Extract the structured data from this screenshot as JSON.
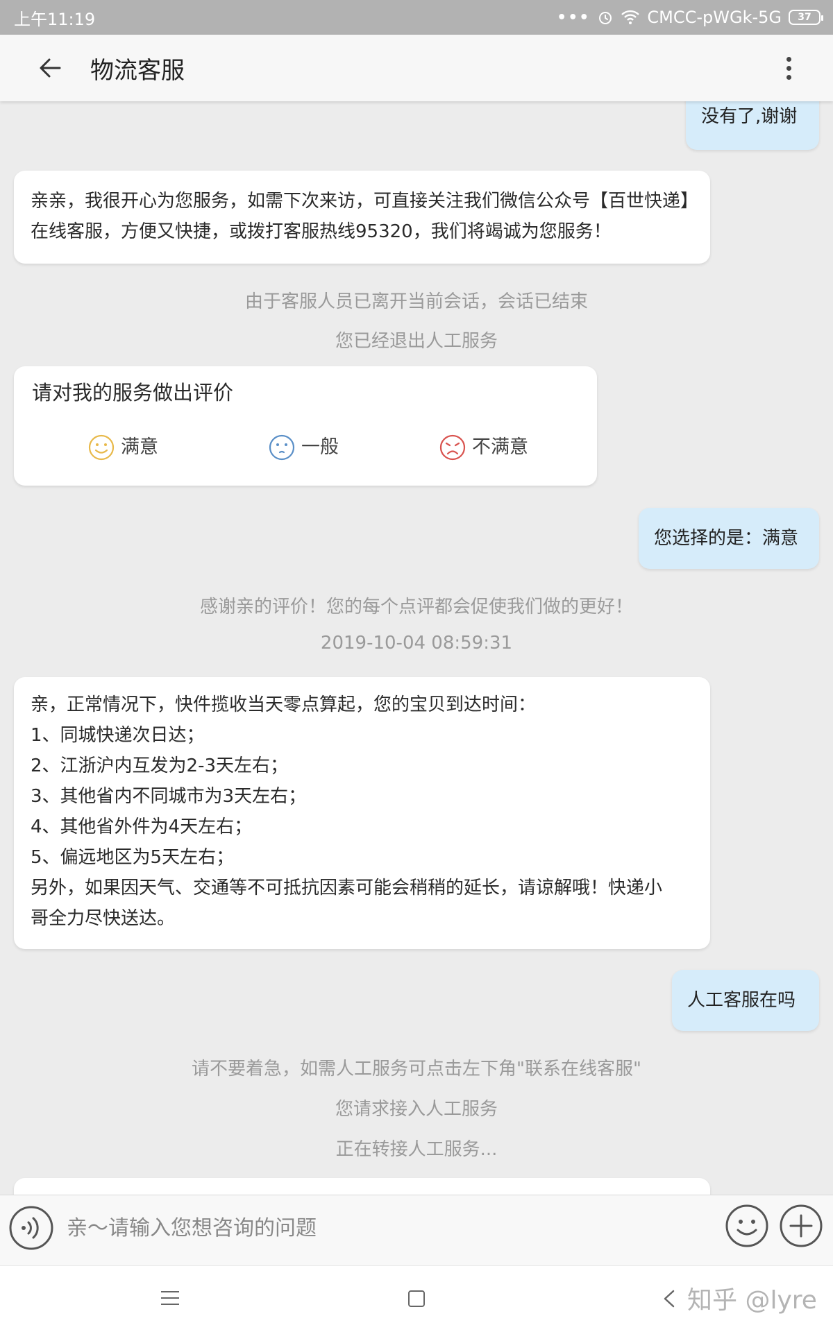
{
  "status_bar": {
    "time": "上午11:19",
    "dots": "•••",
    "network": "CMCC-pWGk-5G",
    "battery": "37"
  },
  "header": {
    "title": "物流客服",
    "back_icon": "arrow-left-icon",
    "more_icon": "more-vertical-icon"
  },
  "messages": {
    "m1": "没有了,谢谢",
    "m2": "亲亲，我很开心为您服务，如需下次来访，可直接关注我们微信公众号【百世快递】在线客服，方便又快捷，或拨打客服热线95320，我们将竭诚为您服务！",
    "sys1": "由于客服人员已离开当前会话，会话已结束",
    "sys2": "您已经退出人工服务",
    "rating": {
      "title": "请对我的服务做出评价",
      "options": [
        {
          "label": "满意",
          "icon": "happy-face-icon",
          "color": "#e8b94a"
        },
        {
          "label": "一般",
          "icon": "neutral-face-icon",
          "color": "#5a8fc7"
        },
        {
          "label": "不满意",
          "icon": "sad-face-icon",
          "color": "#d9534f"
        }
      ]
    },
    "m3": "您选择的是：满意",
    "sys3": "感谢亲的评价！您的每个点评都会促使我们做的更好！",
    "timestamp": "2019-10-04 08:59:31",
    "m4_lines": [
      "亲，正常情况下，快件揽收当天零点算起，您的宝贝到达时间：",
      "1、同城快递次日达；",
      "2、江浙沪内互发为2-3天左右；",
      "3、其他省内不同城市为3天左右；",
      "4、其他省外件为4天左右；",
      "5、偏远地区为5天左右；",
      "另外，如果因天气、交通等不可抵抗因素可能会稍稍的延长，请谅解哦！快递小",
      "哥全力尽快送达。"
    ],
    "m5": "人工客服在吗",
    "sys4": "请不要着急，如需人工服务可点击左下角\"联系在线客服\"",
    "sys5": "您请求接入人工服务",
    "sys6": "正在转接人工服务..."
  },
  "input_bar": {
    "placeholder": "亲～请输入您想咨询的问题",
    "voice_icon": "voice-icon",
    "emoji_icon": "emoji-icon",
    "plus_icon": "plus-icon"
  },
  "nav_bar": {
    "watermark": "知乎 @lyre"
  },
  "colors": {
    "background": "#ececec",
    "user_bubble": "#d6ecfa",
    "bot_bubble": "#ffffff",
    "system_text": "#9a9a9a"
  }
}
